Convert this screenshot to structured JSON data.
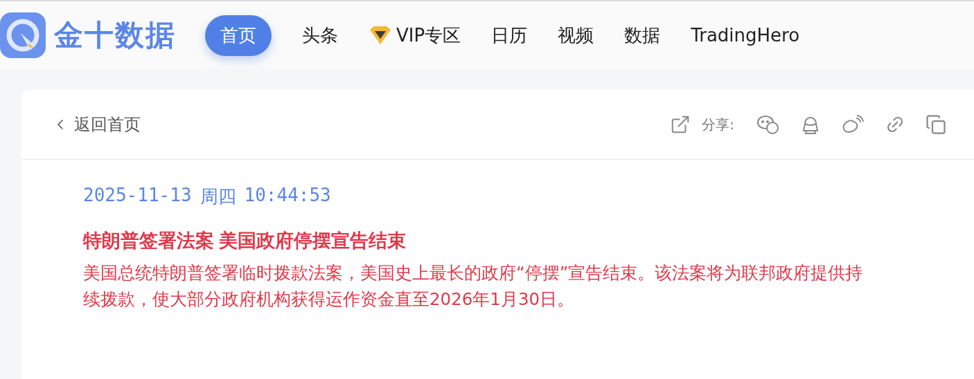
{
  "logo": {
    "text": "金十数据"
  },
  "nav": [
    {
      "label": "首页",
      "selected": true,
      "kind": "plain"
    },
    {
      "label": "头条",
      "selected": false,
      "kind": "plain"
    },
    {
      "label": "VIP专区",
      "selected": false,
      "kind": "vip"
    },
    {
      "label": "日历",
      "selected": false,
      "kind": "plain"
    },
    {
      "label": "视频",
      "selected": false,
      "kind": "plain"
    },
    {
      "label": "数据",
      "selected": false,
      "kind": "plain"
    },
    {
      "label": "TradingHero",
      "selected": false,
      "kind": "plain"
    }
  ],
  "back_link": "返回首页",
  "share": {
    "label": "分享:",
    "targets": [
      {
        "kind": "wechat"
      },
      {
        "kind": "qq"
      },
      {
        "kind": "weibo"
      },
      {
        "kind": "link"
      },
      {
        "kind": "copy"
      }
    ]
  },
  "article": {
    "date": "2025-11-13",
    "weekday": "周四",
    "time": "10:44:53",
    "title": "特朗普签署法案 美国政府停摆宣告结束",
    "body": "美国总统特朗普签署临时拨款法案，美国史上最长的政府“停摆”宣告结束。该法案将为联邦政府提供持续拨款，使大部分政府机构获得运作资金直至2026年1月30日。"
  }
}
